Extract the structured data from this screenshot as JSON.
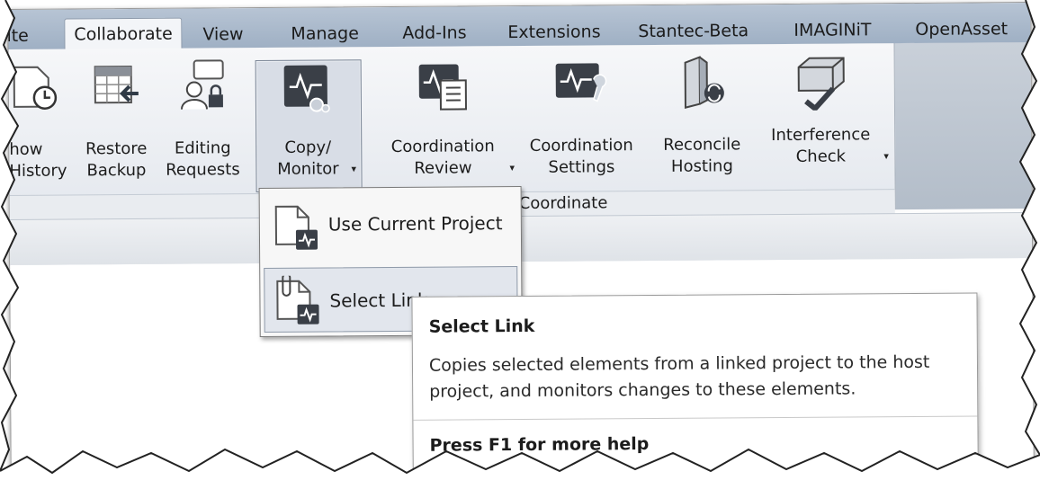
{
  "ribbon_tabs": [
    {
      "label": "ite"
    },
    {
      "label": "Collaborate",
      "active": true
    },
    {
      "label": "View"
    },
    {
      "label": "Manage"
    },
    {
      "label": "Add-Ins"
    },
    {
      "label": "Extensions"
    },
    {
      "label": "Stantec-Beta"
    },
    {
      "label": "IMAGINiT"
    },
    {
      "label": "OpenAsset"
    }
  ],
  "ribbon_buttons": {
    "show_history": "how\nHistory",
    "restore_backup": "Restore\nBackup",
    "editing_requests": "Editing\nRequests",
    "copy_monitor": "Copy/\nMonitor",
    "coordination_review": "Coordination\nReview",
    "coordination_settings": "Coordination\nSettings",
    "reconcile_hosting": "Reconcile\nHosting",
    "interference_check": "Interference\nCheck"
  },
  "panel_label": "Coordinate",
  "dropdown": {
    "items": [
      {
        "label": "Use Current Project"
      },
      {
        "label": "Select Link"
      }
    ]
  },
  "tooltip": {
    "title": "Select Link",
    "description": "Copies selected elements from a linked project to the host project, and monitors changes to these elements.",
    "help": "Press F1 for more help"
  },
  "colors": {
    "tab_bar": "#a9b8ca",
    "ribbon": "#eef0f3",
    "hover": "#e2e6ed",
    "icon_dark": "#3a3f47"
  },
  "icons": [
    "history-icon",
    "restore-backup-icon",
    "editing-requests-icon",
    "copy-monitor-icon",
    "coordination-review-icon",
    "coordination-settings-icon",
    "reconcile-hosting-icon",
    "interference-check-icon",
    "use-current-project-icon",
    "select-link-icon"
  ]
}
